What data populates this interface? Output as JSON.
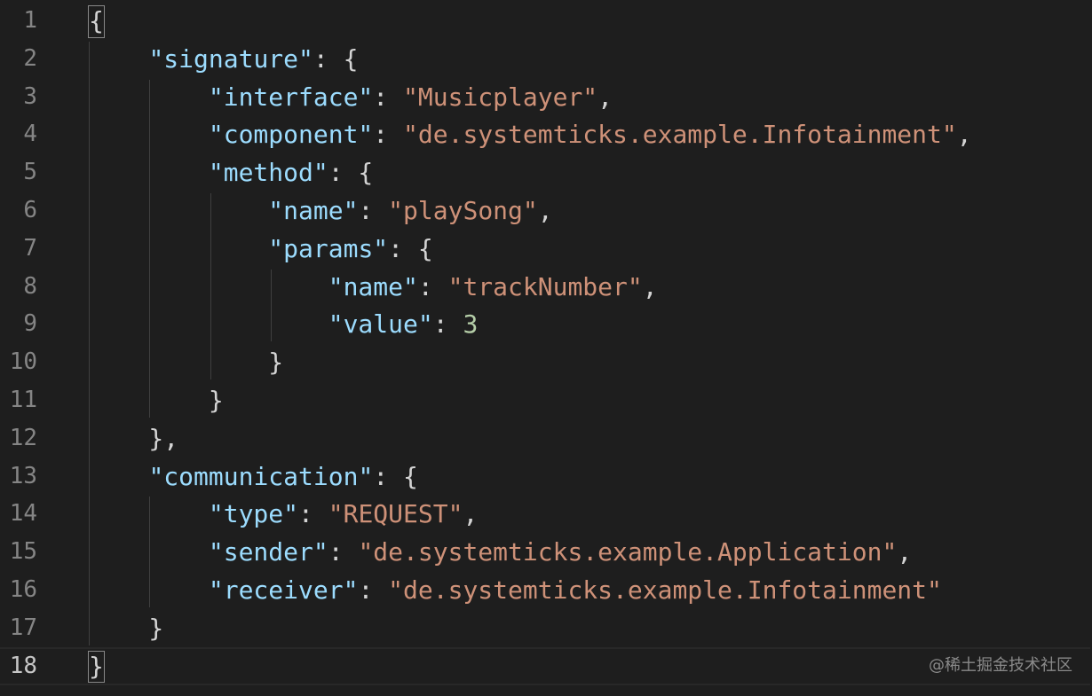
{
  "editor": {
    "language": "json",
    "current_line": 18,
    "colors": {
      "background": "#1e1e1e",
      "line_number": "#858585",
      "key": "#9cdcfe",
      "string": "#ce9178",
      "number": "#b5cea8",
      "punctuation": "#d4d4d4"
    },
    "lines": [
      {
        "num": "1",
        "tokens": [
          {
            "t": "p",
            "v": "{"
          }
        ]
      },
      {
        "num": "2",
        "tokens": [
          {
            "t": "p",
            "v": "    "
          },
          {
            "t": "k",
            "v": "\"signature\""
          },
          {
            "t": "p",
            "v": ": {"
          }
        ]
      },
      {
        "num": "3",
        "tokens": [
          {
            "t": "p",
            "v": "        "
          },
          {
            "t": "k",
            "v": "\"interface\""
          },
          {
            "t": "p",
            "v": ": "
          },
          {
            "t": "s",
            "v": "\"Musicplayer\""
          },
          {
            "t": "p",
            "v": ","
          }
        ]
      },
      {
        "num": "4",
        "tokens": [
          {
            "t": "p",
            "v": "        "
          },
          {
            "t": "k",
            "v": "\"component\""
          },
          {
            "t": "p",
            "v": ": "
          },
          {
            "t": "s",
            "v": "\"de.systemticks.example.Infotainment\""
          },
          {
            "t": "p",
            "v": ","
          }
        ]
      },
      {
        "num": "5",
        "tokens": [
          {
            "t": "p",
            "v": "        "
          },
          {
            "t": "k",
            "v": "\"method\""
          },
          {
            "t": "p",
            "v": ": {"
          }
        ]
      },
      {
        "num": "6",
        "tokens": [
          {
            "t": "p",
            "v": "            "
          },
          {
            "t": "k",
            "v": "\"name\""
          },
          {
            "t": "p",
            "v": ": "
          },
          {
            "t": "s",
            "v": "\"playSong\""
          },
          {
            "t": "p",
            "v": ","
          }
        ]
      },
      {
        "num": "7",
        "tokens": [
          {
            "t": "p",
            "v": "            "
          },
          {
            "t": "k",
            "v": "\"params\""
          },
          {
            "t": "p",
            "v": ": {"
          }
        ]
      },
      {
        "num": "8",
        "tokens": [
          {
            "t": "p",
            "v": "                "
          },
          {
            "t": "k",
            "v": "\"name\""
          },
          {
            "t": "p",
            "v": ": "
          },
          {
            "t": "s",
            "v": "\"trackNumber\""
          },
          {
            "t": "p",
            "v": ","
          }
        ]
      },
      {
        "num": "9",
        "tokens": [
          {
            "t": "p",
            "v": "                "
          },
          {
            "t": "k",
            "v": "\"value\""
          },
          {
            "t": "p",
            "v": ": "
          },
          {
            "t": "n",
            "v": "3"
          }
        ]
      },
      {
        "num": "10",
        "tokens": [
          {
            "t": "p",
            "v": "            }"
          }
        ]
      },
      {
        "num": "11",
        "tokens": [
          {
            "t": "p",
            "v": "        }"
          }
        ]
      },
      {
        "num": "12",
        "tokens": [
          {
            "t": "p",
            "v": "    },"
          }
        ]
      },
      {
        "num": "13",
        "tokens": [
          {
            "t": "p",
            "v": "    "
          },
          {
            "t": "k",
            "v": "\"communication\""
          },
          {
            "t": "p",
            "v": ": {"
          }
        ]
      },
      {
        "num": "14",
        "tokens": [
          {
            "t": "p",
            "v": "        "
          },
          {
            "t": "k",
            "v": "\"type\""
          },
          {
            "t": "p",
            "v": ": "
          },
          {
            "t": "s",
            "v": "\"REQUEST\""
          },
          {
            "t": "p",
            "v": ","
          }
        ]
      },
      {
        "num": "15",
        "tokens": [
          {
            "t": "p",
            "v": "        "
          },
          {
            "t": "k",
            "v": "\"sender\""
          },
          {
            "t": "p",
            "v": ": "
          },
          {
            "t": "s",
            "v": "\"de.systemticks.example.Application\""
          },
          {
            "t": "p",
            "v": ","
          }
        ]
      },
      {
        "num": "16",
        "tokens": [
          {
            "t": "p",
            "v": "        "
          },
          {
            "t": "k",
            "v": "\"receiver\""
          },
          {
            "t": "p",
            "v": ": "
          },
          {
            "t": "s",
            "v": "\"de.systemticks.example.Infotainment\""
          }
        ]
      },
      {
        "num": "17",
        "tokens": [
          {
            "t": "p",
            "v": "    }"
          }
        ]
      },
      {
        "num": "18",
        "tokens": [
          {
            "t": "p",
            "v": "}"
          }
        ]
      }
    ]
  },
  "watermark": "@稀土掘金技术社区"
}
